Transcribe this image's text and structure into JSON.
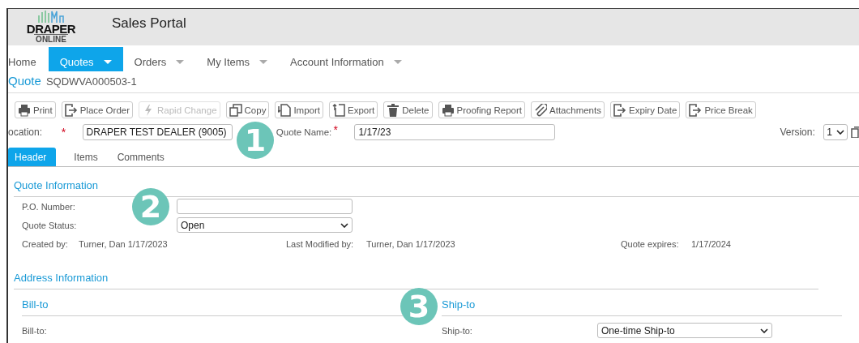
{
  "header": {
    "logo": {
      "brand": "DRAPER",
      "sub": "ONLINE"
    },
    "title": "Sales Portal"
  },
  "nav": [
    {
      "label": "Home",
      "selected": false,
      "has_menu": false
    },
    {
      "label": "Quotes",
      "selected": true,
      "has_menu": true
    },
    {
      "label": "Orders",
      "selected": false,
      "has_menu": true
    },
    {
      "label": "My Items",
      "selected": false,
      "has_menu": true
    },
    {
      "label": "Account Information",
      "selected": false,
      "has_menu": true
    }
  ],
  "quote": {
    "label": "Quote",
    "number": "SQDWVA000503-1"
  },
  "toolbar": [
    {
      "label": "Print",
      "kind": "print",
      "disabled": false
    },
    {
      "label": "Place Order",
      "kind": "exit",
      "disabled": false
    },
    {
      "label": "Rapid Change",
      "kind": "bolt",
      "disabled": true
    },
    {
      "label": "Copy",
      "kind": "copy",
      "disabled": false
    },
    {
      "label": "Import",
      "kind": "import",
      "disabled": false
    },
    {
      "label": "Export",
      "kind": "export",
      "disabled": false
    },
    {
      "label": "Delete",
      "kind": "trash",
      "disabled": false
    },
    {
      "label": "Proofing Report",
      "kind": "print",
      "disabled": false
    },
    {
      "label": "Attachments",
      "kind": "clip",
      "disabled": false
    },
    {
      "label": "Expiry Date",
      "kind": "exit",
      "disabled": false
    },
    {
      "label": "Price Break",
      "kind": "exit",
      "disabled": false
    }
  ],
  "location": {
    "label": "ocation:",
    "required_marker": "*",
    "value": "DRAPER TEST DEALER (9005)"
  },
  "quote_name": {
    "label": "Quote Name:",
    "required_marker": "*",
    "value": "1/17/23"
  },
  "version": {
    "label": "Version:",
    "value": "1"
  },
  "tabs": [
    {
      "label": "Header",
      "selected": true
    },
    {
      "label": "Items",
      "selected": false
    },
    {
      "label": "Comments",
      "selected": false
    }
  ],
  "quote_information": {
    "title": "Quote Information",
    "po_number": {
      "label": "P.O. Number:"
    },
    "quote_status": {
      "label": "Quote Status:",
      "value": "Open"
    },
    "created_by": {
      "label": "Created by:",
      "value": "Turner, Dan 1/17/2023"
    },
    "last_modified_by": {
      "label": "Last Modified by:",
      "value": "Turner, Dan 1/17/2023"
    },
    "quote_expires": {
      "label": "Quote expires:",
      "value": "1/17/2024"
    }
  },
  "address_information": {
    "title": "Address Information",
    "bill_to": {
      "title": "Bill-to",
      "field_label": "Bill-to:"
    },
    "ship_to": {
      "title": "Ship-to",
      "field_label": "Ship-to:",
      "value": "One-time Ship-to"
    }
  },
  "badges": [
    "1",
    "2",
    "3"
  ]
}
